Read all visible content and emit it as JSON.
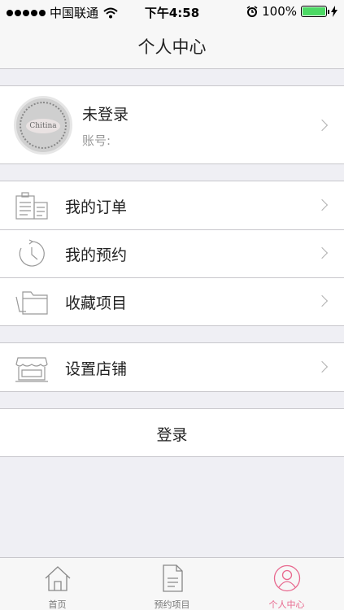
{
  "status_bar": {
    "carrier": "中国联通",
    "time": "下午4:58",
    "battery": "100%",
    "battery_level": 1.0
  },
  "nav": {
    "title": "个人中心"
  },
  "profile": {
    "name": "未登录",
    "account_label": "账号:",
    "avatar_text": "Chitina"
  },
  "menu": {
    "orders": "我的订单",
    "appointments": "我的预约",
    "favorites": "收藏项目",
    "shop_settings": "设置店铺"
  },
  "login": {
    "label": "登录"
  },
  "tabs": [
    {
      "label": "首页",
      "icon": "home-icon",
      "active": false
    },
    {
      "label": "预约项目",
      "icon": "document-icon",
      "active": false
    },
    {
      "label": "个人中心",
      "icon": "user-icon",
      "active": true
    }
  ],
  "colors": {
    "accent": "#e8688e",
    "battery": "#4cd964",
    "background": "#efeff4",
    "separator": "#c8c7cc"
  }
}
